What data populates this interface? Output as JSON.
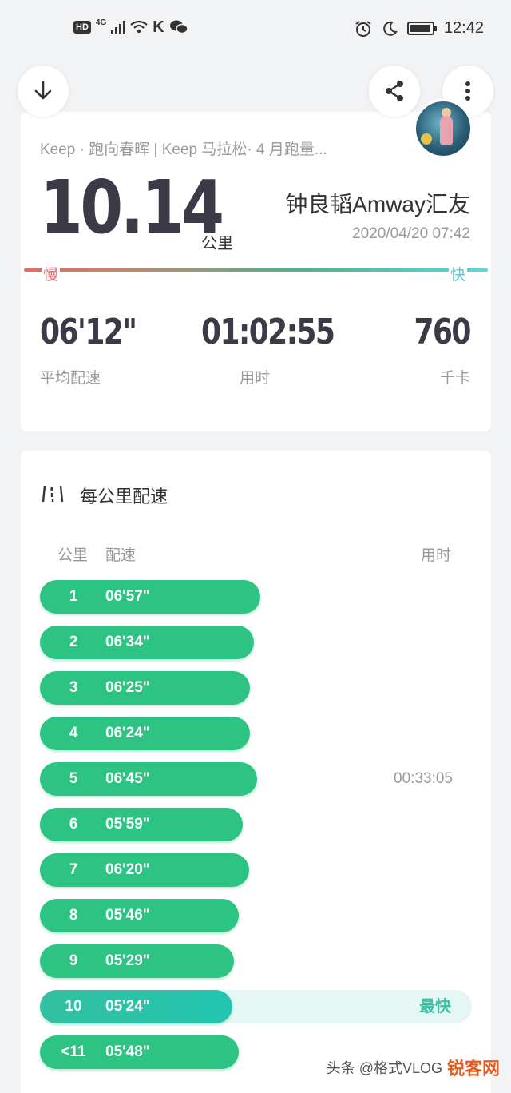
{
  "status_bar": {
    "hd": "HD",
    "network": "4G",
    "carrier_glyph": "K",
    "time": "12:42"
  },
  "summary": {
    "event_title": "Keep · 跑向春晖 | Keep 马拉松· 4 月跑量...",
    "distance": "10.14",
    "distance_unit": "公里",
    "runner_name": "钟良韬Amway汇友",
    "date": "2020/04/20 07:42",
    "speed_slow": "慢",
    "speed_fast": "快",
    "stats": {
      "avg_pace_value": "06'12\"",
      "avg_pace_label": "平均配速",
      "duration_value": "01:02:55",
      "duration_label": "用时",
      "calories_value": "760",
      "calories_label": "千卡"
    }
  },
  "pace_section": {
    "title": "每公里配速",
    "col_km": "公里",
    "col_pace": "配速",
    "col_time": "用时",
    "fastest_label": "最快",
    "splits": [
      {
        "km": "1",
        "pace": "06'57\"",
        "fraction": 0.51,
        "time": "",
        "fastest": false
      },
      {
        "km": "2",
        "pace": "06'34\"",
        "fraction": 0.495,
        "time": "",
        "fastest": false
      },
      {
        "km": "3",
        "pace": "06'25\"",
        "fraction": 0.487,
        "time": "",
        "fastest": false
      },
      {
        "km": "4",
        "pace": "06'24\"",
        "fraction": 0.486,
        "time": "",
        "fastest": false
      },
      {
        "km": "5",
        "pace": "06'45\"",
        "fraction": 0.503,
        "time": "00:33:05",
        "fastest": false
      },
      {
        "km": "6",
        "pace": "05'59\"",
        "fraction": 0.47,
        "time": "",
        "fastest": false
      },
      {
        "km": "7",
        "pace": "06'20\"",
        "fraction": 0.485,
        "time": "",
        "fastest": false
      },
      {
        "km": "8",
        "pace": "05'46\"",
        "fraction": 0.46,
        "time": "",
        "fastest": false
      },
      {
        "km": "9",
        "pace": "05'29\"",
        "fraction": 0.45,
        "time": "",
        "fastest": false
      },
      {
        "km": "10",
        "pace": "05'24\"",
        "fraction": 0.445,
        "time": "",
        "fastest": true
      },
      {
        "km": "<11",
        "pace": "05'48\"",
        "fraction": 0.461,
        "time": "",
        "fastest": false
      }
    ]
  },
  "watermark": {
    "text": "头条 @格式VLOG",
    "logo": "锐客网"
  },
  "colors": {
    "bar_green": "#2dc382",
    "fastest_teal": "#33c0a0",
    "slow_red": "#e46b6b",
    "fast_cyan": "#4fc9d4"
  }
}
